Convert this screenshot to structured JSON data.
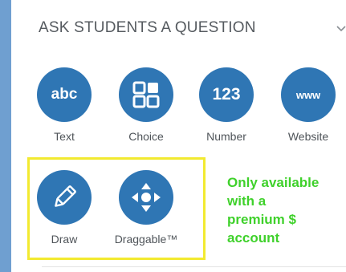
{
  "panel": {
    "title": "ASK STUDENTS A QUESTION",
    "collapse_icon": "chevron-down-icon"
  },
  "tools": [
    {
      "label": "Text",
      "glyph": "abc",
      "icon": "text-icon"
    },
    {
      "label": "Choice",
      "glyph": "",
      "icon": "choice-grid-icon"
    },
    {
      "label": "Number",
      "glyph": "123",
      "icon": "number-icon"
    },
    {
      "label": "Website",
      "glyph": "www",
      "icon": "website-icon"
    },
    {
      "label": "Draw",
      "glyph": "",
      "icon": "pencil-icon"
    },
    {
      "label": "Draggable™",
      "glyph": "",
      "icon": "move-arrows-icon"
    }
  ],
  "premium_note": {
    "line1": "Only available",
    "line2": "with a",
    "line3": "premium $",
    "line4": "account"
  },
  "colors": {
    "accent": "#2f76b4",
    "highlight_border": "#f2ea30",
    "premium_text": "#3fd12b",
    "page_background": "#6f9fd0"
  }
}
